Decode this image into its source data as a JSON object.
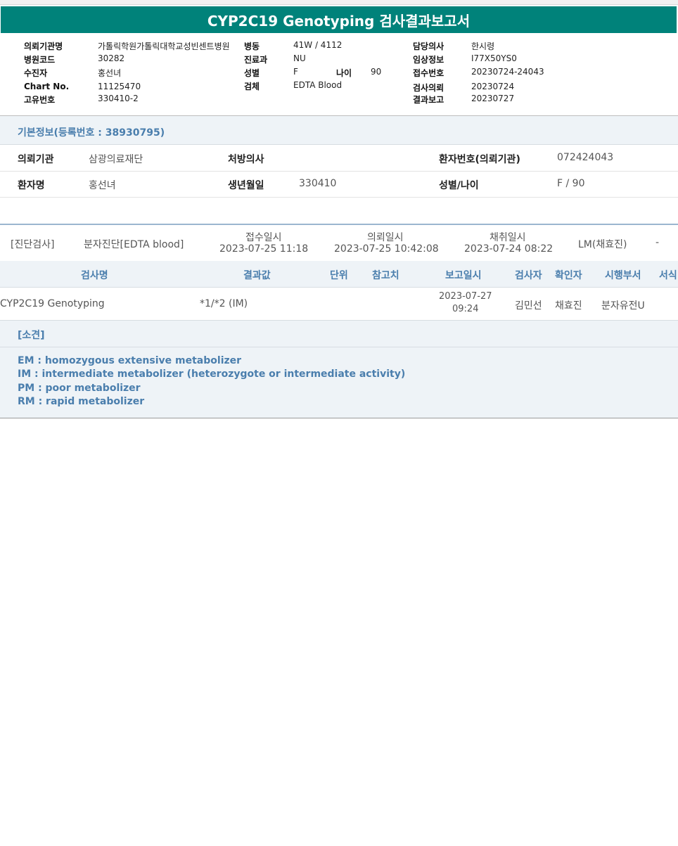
{
  "title": "CYP2C19 Genotyping 검사결과보고서",
  "header": {
    "col1": [
      {
        "label": "의뢰기관명",
        "value": "가톨릭학원가톨릭대학교성빈센트병원"
      },
      {
        "label": "병원코드",
        "value": "30282"
      },
      {
        "label": "수진자",
        "value": "홍선녀"
      },
      {
        "label": "Chart No.",
        "value": "11125470"
      },
      {
        "label": "고유번호",
        "value": "330410-2"
      }
    ],
    "col2": [
      {
        "label": "병동",
        "value": "41W / 4112"
      },
      {
        "label": "진료과",
        "value": "NU"
      },
      {
        "label": "성별",
        "value": "F"
      },
      {
        "label": "검체",
        "value": "EDTA Blood"
      }
    ],
    "age": {
      "label": "나이",
      "value": "90"
    },
    "col3": [
      {
        "label": "담당의사",
        "value": "한시령"
      },
      {
        "label": "임상정보",
        "value": "I77X50YS0"
      },
      {
        "label": "접수번호",
        "value": "20230724-24043"
      },
      {
        "label": "검사의뢰",
        "value": "20230724"
      },
      {
        "label": "결과보고",
        "value": "20230727"
      }
    ]
  },
  "basic_info": {
    "heading": "기본정보(등록번호 : 38930795)",
    "rows": [
      {
        "k1": "의뢰기관",
        "v1": "삼광의료재단",
        "k2": "처방의사",
        "v2": "",
        "k3": "환자번호(의뢰기관)",
        "v3": "072424043"
      },
      {
        "k1": "환자명",
        "v1": "홍선녀",
        "k2": "생년월일",
        "v2": "330410",
        "k3": "성별/나이",
        "v3": "F / 90"
      }
    ]
  },
  "exam": {
    "category": "[진단검사]",
    "type": "분자진단[EDTA blood]",
    "received_label": "접수일시",
    "received": "2023-07-25 11:18",
    "requested_label": "의뢰일시",
    "requested": "2023-07-25 10:42:08",
    "collected_label": "채취일시",
    "collected": "2023-07-24 08:22",
    "collector": "LM(채효진)",
    "dash": "-"
  },
  "results": {
    "columns": [
      "검사명",
      "결과값",
      "단위",
      "참고치",
      "보고일시",
      "검사자",
      "확인자",
      "시행부서",
      "서식"
    ],
    "row": {
      "name": "CYP2C19 Genotyping",
      "value": "*1/*2 (IM)",
      "report_date": "2023-07-27",
      "report_time": "09:24",
      "tester": "김민선",
      "verifier": "채효진",
      "department": "분자유전U"
    }
  },
  "opinion": {
    "heading": "[소견]",
    "lines": [
      "EM : homozygous extensive metabolizer",
      "IM  : intermediate metabolizer (heterozygote or intermediate activity)",
      "PM : poor metabolizer",
      "RM : rapid metabolizer"
    ]
  }
}
